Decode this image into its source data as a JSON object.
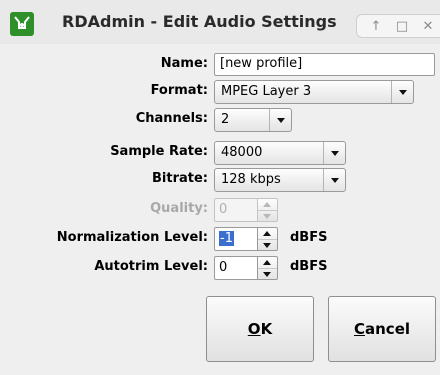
{
  "window": {
    "title": "RDAdmin - Edit Audio Settings",
    "controls": [
      "↑",
      "□",
      "✕"
    ]
  },
  "form": {
    "name": {
      "label": "Name:",
      "value": "[new profile]"
    },
    "format": {
      "label": "Format:",
      "value": "MPEG Layer 3"
    },
    "channels": {
      "label": "Channels:",
      "value": "2"
    },
    "sample_rate": {
      "label": "Sample Rate:",
      "value": "48000"
    },
    "bitrate": {
      "label": "Bitrate:",
      "value": "128 kbps"
    },
    "quality": {
      "label": "Quality:",
      "value": "0",
      "enabled": false
    },
    "normalization": {
      "label": "Normalization Level:",
      "value": "-1",
      "unit": "dBFS"
    },
    "autotrim": {
      "label": "Autotrim Level:",
      "value": "0",
      "unit": "dBFS"
    }
  },
  "buttons": {
    "ok": {
      "mnemonic": "O",
      "rest": "K"
    },
    "cancel": {
      "mnemonic": "C",
      "rest": "ancel"
    }
  },
  "colors": {
    "app_icon": "#2f8f2a",
    "selection": "#3b6fcf",
    "window_bg": "#efefef"
  }
}
